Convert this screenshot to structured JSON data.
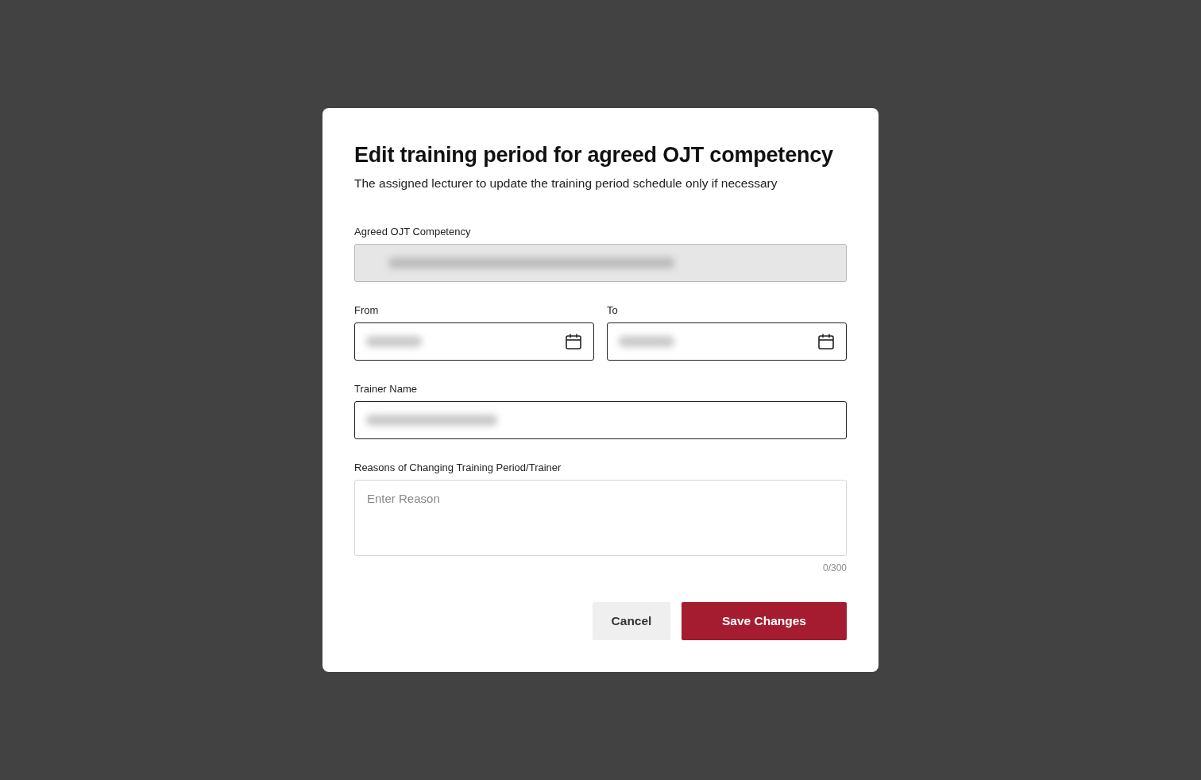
{
  "dialog": {
    "title": "Edit training period for agreed OJT competency",
    "subtitle": "The assigned lecturer to update the training period schedule only if necessary",
    "fields": [
      {
        "kind": "text",
        "label": "Agreed OJT Competency",
        "disabled": true,
        "redacted": true
      },
      {
        "kind": "dates",
        "items": [
          {
            "label": "From",
            "redacted": true
          },
          {
            "label": "To",
            "redacted": true
          }
        ]
      },
      {
        "kind": "text",
        "label": "Trainer Name",
        "disabled": false,
        "redacted": true
      },
      {
        "kind": "textarea",
        "label": "Reasons of Changing Training Period/Trainer",
        "placeholder": "Enter Reason",
        "counter": "0/300"
      }
    ],
    "buttons": [
      {
        "label": "Cancel",
        "kind": "secondary"
      },
      {
        "label": "Save Changes",
        "kind": "primary"
      }
    ]
  }
}
